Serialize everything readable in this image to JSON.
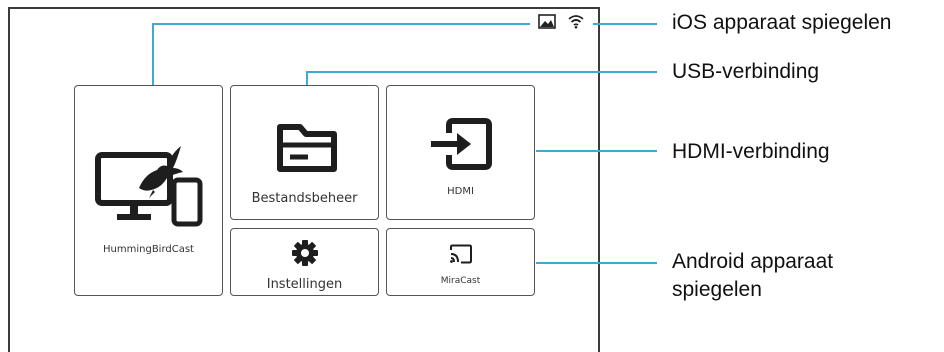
{
  "status_bar": {
    "icons": [
      "screen-mirror-icon",
      "wifi-icon"
    ]
  },
  "tiles": {
    "hummingbird": {
      "label": "HummingBirdCast",
      "icon": "monitor-bird-phone-icon"
    },
    "file_manager": {
      "label": "Bestandsbeheer",
      "icon": "folder-icon"
    },
    "hdmi": {
      "label": "HDMI",
      "icon": "input-arrow-icon"
    },
    "settings": {
      "label": "Instellingen",
      "icon": "gear-icon"
    },
    "miracast": {
      "label": "MiraCast",
      "icon": "cast-icon"
    }
  },
  "annotations": {
    "ios": "iOS apparaat spiegelen",
    "usb": "USB-verbinding",
    "hdmi": "HDMI-verbinding",
    "android_line1": "Android apparaat",
    "android_line2": "spiegelen"
  },
  "colors": {
    "leader_line": "#3fa9d6",
    "icon": "#1e1e1e",
    "frame": "#3b3b3b"
  }
}
